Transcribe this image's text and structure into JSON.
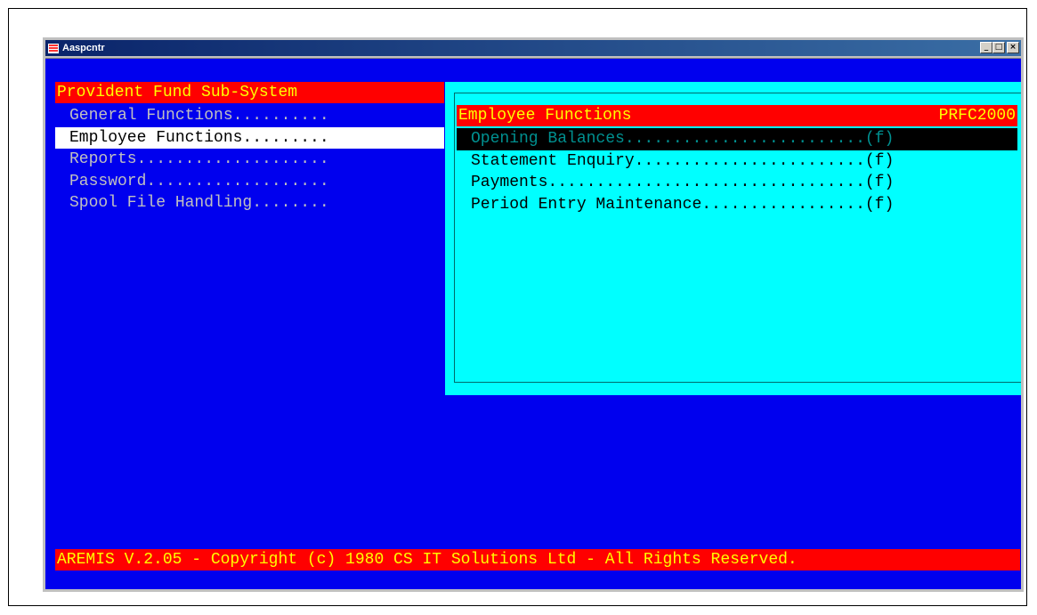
{
  "window": {
    "title": "Aaspcntr",
    "minimize": "_",
    "maximize": "□",
    "close": "×"
  },
  "left": {
    "title": "Provident Fund Sub-System",
    "items": [
      {
        "label": "General Functions.........."
      },
      {
        "label": "Employee Functions........."
      },
      {
        "label": "Reports...................."
      },
      {
        "label": "Password..................."
      },
      {
        "label": "Spool File Handling........"
      }
    ]
  },
  "panel": {
    "title": "Employee Functions",
    "code": "PRFC2000",
    "items": [
      {
        "label": "Opening Balances.........................(f)"
      },
      {
        "label": "Statement Enquiry........................(f)"
      },
      {
        "label": "Payments.................................(f)"
      },
      {
        "label": "Period Entry Maintenance.................(f)"
      }
    ]
  },
  "status": "AREMIS V.2.05 - Copyright (c) 1980 CS IT Solutions Ltd - All Rights Reserved.",
  "colors": {
    "console_bg": "#0000ee",
    "highlight_bar": "#ff0000",
    "highlight_text": "#ffff00",
    "panel_bg": "#00ffff"
  }
}
